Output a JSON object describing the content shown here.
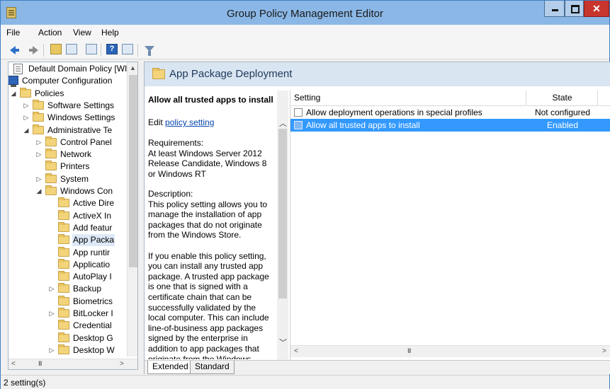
{
  "window": {
    "title": "Group Policy Management Editor"
  },
  "menu": [
    "File",
    "Action",
    "View",
    "Help"
  ],
  "tree": {
    "items": [
      {
        "label": "Default Domain Policy [WIN",
        "expander": "",
        "icon": "policy-doc-icon"
      },
      {
        "label": "Computer Configuration",
        "expander": "◢",
        "icon": "computer-icon"
      },
      {
        "label": "Policies",
        "expander": "◢",
        "icon": "folder-icon"
      },
      {
        "label": "Software Settings",
        "expander": "▷",
        "icon": "folder-icon"
      },
      {
        "label": "Windows Settings",
        "expander": "▷",
        "icon": "folder-icon"
      },
      {
        "label": "Administrative Te",
        "expander": "◢",
        "icon": "folder-icon"
      },
      {
        "label": "Control Panel",
        "expander": "▷",
        "icon": "folder-icon"
      },
      {
        "label": "Network",
        "expander": "▷",
        "icon": "folder-icon"
      },
      {
        "label": "Printers",
        "expander": "",
        "icon": "folder-icon"
      },
      {
        "label": "System",
        "expander": "▷",
        "icon": "folder-icon"
      },
      {
        "label": "Windows Con",
        "expander": "◢",
        "icon": "folder-icon"
      },
      {
        "label": "Active Dire",
        "expander": "",
        "icon": "folder-icon"
      },
      {
        "label": "ActiveX In",
        "expander": "",
        "icon": "folder-icon"
      },
      {
        "label": "Add featur",
        "expander": "",
        "icon": "folder-icon"
      },
      {
        "label": "App Packa",
        "expander": "",
        "icon": "folder-icon",
        "selected": true
      },
      {
        "label": "App runtir",
        "expander": "",
        "icon": "folder-icon"
      },
      {
        "label": "Applicatio",
        "expander": "",
        "icon": "folder-icon"
      },
      {
        "label": "AutoPlay I",
        "expander": "",
        "icon": "folder-icon"
      },
      {
        "label": "Backup",
        "expander": "▷",
        "icon": "folder-icon"
      },
      {
        "label": "Biometrics",
        "expander": "",
        "icon": "folder-icon"
      },
      {
        "label": "BitLocker I",
        "expander": "▷",
        "icon": "folder-icon"
      },
      {
        "label": "Credential",
        "expander": "",
        "icon": "folder-icon"
      },
      {
        "label": "Desktop G",
        "expander": "",
        "icon": "folder-icon"
      },
      {
        "label": "Desktop W",
        "expander": "▷",
        "icon": "folder-icon"
      }
    ],
    "scroll_grip": "III"
  },
  "right": {
    "header_title": "App Package Deployment",
    "description": {
      "title": "Allow all trusted apps to install",
      "edit_prefix": "Edit ",
      "edit_link": "policy setting",
      "requirements": "Requirements:\nAt least Windows Server 2012 Release Candidate, Windows 8 or Windows RT",
      "body": "Description:\nThis policy setting allows you to manage the installation of app packages that do not originate from the Windows Store.\n\nIf you enable this policy setting, you can install any trusted app package. A trusted app package is one that is signed with a certificate chain that can be successfully validated by the local computer. This can include line-of-business app packages signed by the enterprise in addition to app packages that originate from the Windows Store."
    },
    "columns": {
      "setting": "Setting",
      "state": "State"
    },
    "rows": [
      {
        "name": "Allow deployment operations in special profiles",
        "state": "Not configured",
        "selected": false
      },
      {
        "name": "Allow all trusted apps to install",
        "state": "Enabled",
        "selected": true
      }
    ],
    "list_scroll_grip": "III",
    "tabs": [
      "Extended",
      "Standard"
    ]
  },
  "status": {
    "text": "2 setting(s)"
  },
  "colors": {
    "selection": "#3399ff",
    "header_band": "#d9e5f1",
    "titlebar": "#8ab7e6",
    "close_button": "#c7352d"
  }
}
